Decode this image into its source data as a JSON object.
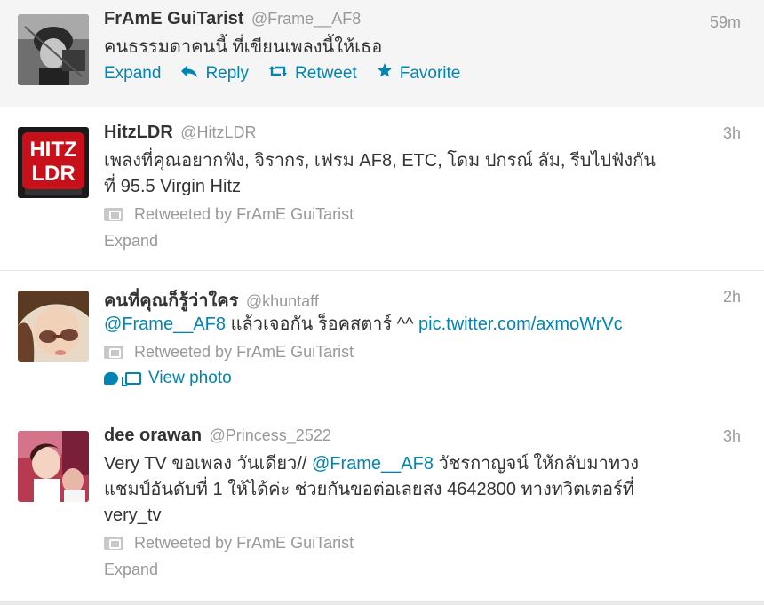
{
  "tweets": [
    {
      "fullname": "FrAmE GuiTarist",
      "username": "@Frame__AF8",
      "time": "59m",
      "text": "คนธรรมดาคนนี้ ที่เขียนเพลงนี้ให้เธอ",
      "actions": {
        "expand": "Expand",
        "reply": "Reply",
        "retweet": "Retweet",
        "favorite": "Favorite"
      }
    },
    {
      "fullname": "HitzLDR",
      "username": "@HitzLDR",
      "time": "3h",
      "text_line1": "เพลงที่คุณอยากฟัง, จิรากร, เฟรม AF8, ETC, โดม ปกรณ์ ลัม, รีบไปฟังกัน",
      "text_line2": "ที่ 95.5 Virgin Hitz",
      "retweeted_by": "Retweeted by FrAmE GuiTarist",
      "expand": "Expand",
      "avatar_text_top": "HITZ",
      "avatar_text_bottom": "LDR"
    },
    {
      "fullname": "คนที่คุณก็รู้ว่าใคร",
      "username": "@khuntaff",
      "time": "2h",
      "mention": "@Frame__AF8",
      "text_middle": " แล้วเจอกัน ร็อคสตาร์ ^^ ",
      "pic_link": "pic.twitter.com/axmoWrVc",
      "retweeted_by": "Retweeted by FrAmE GuiTarist",
      "view_photo": "View photo"
    },
    {
      "fullname": "dee orawan",
      "username": "@Princess_2522",
      "time": "3h",
      "text_start": "Very TV ขอเพลง วันเดียว// ",
      "mention": "@Frame__AF8",
      "text_after_mention": " วัชรกาญจน์ ให้กลับมาทวง",
      "text_line2": "แชมป์อันดับที่ 1 ให้ได้ค่ะ ช่วยกันขอต่อเลยสง 4642800 ทางทวิตเตอร์ที่",
      "text_line3": "very_tv",
      "retweeted_by": "Retweeted by FrAmE GuiTarist",
      "expand": "Expand"
    }
  ],
  "colors": {
    "link": "#0084b4",
    "muted": "#999999",
    "text": "#333333"
  },
  "icons": [
    "reply-arrow-icon",
    "retweet-icon",
    "star-icon",
    "retweet-small-icon",
    "speech-bubble-icon",
    "photo-icon"
  ]
}
